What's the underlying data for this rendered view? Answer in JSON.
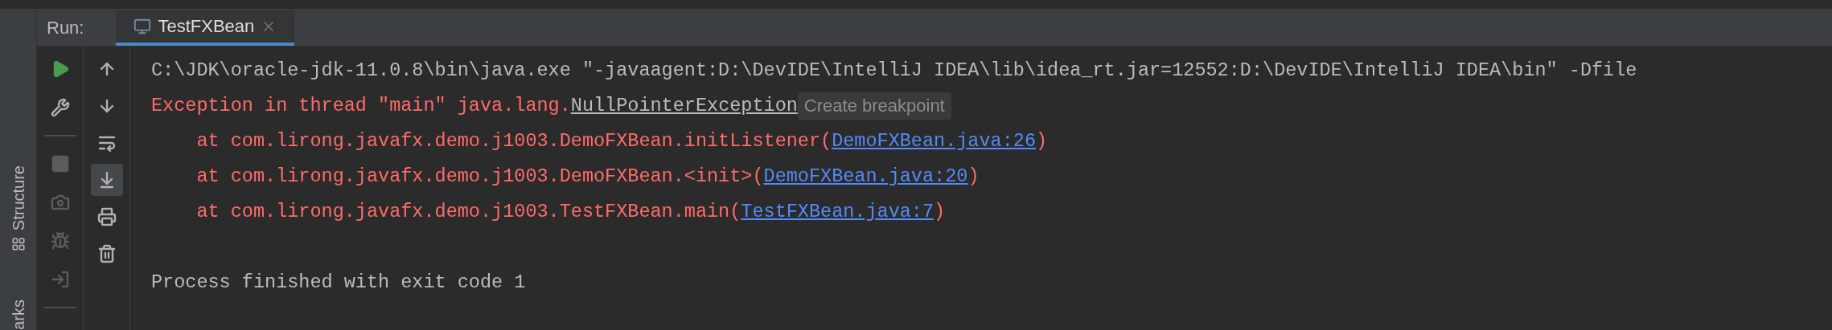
{
  "run_panel": {
    "label": "Run:",
    "tabs": [
      {
        "title": "TestFXBean",
        "selected": true
      }
    ]
  },
  "side_tabs": [
    {
      "label": "Structure"
    },
    {
      "label": "arks"
    }
  ],
  "toolbar_left": [
    {
      "kind": "run",
      "disabled": false
    },
    {
      "kind": "wrench",
      "disabled": false
    },
    {
      "kind": "divider"
    },
    {
      "kind": "stop",
      "disabled": true
    },
    {
      "kind": "camera",
      "disabled": true
    },
    {
      "kind": "bug",
      "disabled": true
    },
    {
      "kind": "exit",
      "disabled": true
    },
    {
      "kind": "divider"
    }
  ],
  "toolbar_right": [
    {
      "kind": "up",
      "selected": false
    },
    {
      "kind": "down",
      "selected": false
    },
    {
      "kind": "wrap",
      "selected": false
    },
    {
      "kind": "scroll-end",
      "selected": true
    },
    {
      "kind": "print",
      "selected": false
    },
    {
      "kind": "trash",
      "selected": false
    }
  ],
  "console": [
    {
      "kind": "command",
      "text": "C:\\JDK\\oracle-jdk-11.0.8\\bin\\java.exe \"-javaagent:D:\\DevIDE\\IntelliJ IDEA\\lib\\idea_rt.jar=12552:D:\\DevIDE\\IntelliJ IDEA\\bin\" -Dfile"
    },
    {
      "kind": "exception",
      "text": "Exception in thread \"main\" java.lang.",
      "link": "NullPointerException",
      "tooltip": "Create breakpoint"
    },
    {
      "kind": "trace",
      "text": "    at com.lirong.javafx.demo.j1003.DemoFXBean.initListener(",
      "link": "DemoFXBean.java:26",
      "suffix": ")"
    },
    {
      "kind": "trace",
      "text": "    at com.lirong.javafx.demo.j1003.DemoFXBean.<init>(",
      "link": "DemoFXBean.java:20",
      "suffix": ")"
    },
    {
      "kind": "trace",
      "text": "    at com.lirong.javafx.demo.j1003.TestFXBean.main(",
      "link": "TestFXBean.java:7",
      "suffix": ")"
    },
    {
      "kind": "exit",
      "text": "Process finished with exit code 1"
    }
  ]
}
